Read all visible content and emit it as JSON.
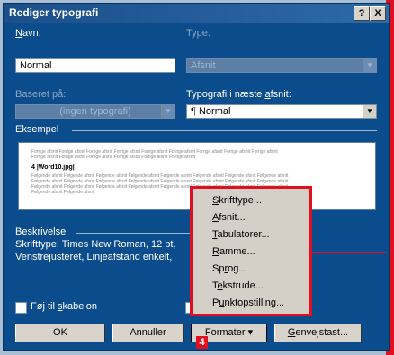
{
  "dialog": {
    "title": "Rediger typografi",
    "help_button": "?",
    "close_button": "X"
  },
  "fields": {
    "name_label_pre": "",
    "name_label_u": "N",
    "name_label_post": "avn:",
    "name_value": "Normal",
    "type_label": "Type:",
    "type_value": "Afsnit",
    "based_on_label": "Baseret på:",
    "based_on_value": "(ingen typografi)",
    "next_style_label_pre": "Typografi i næste ",
    "next_style_label_u": "a",
    "next_style_label_post": "fsnit:",
    "next_style_value": "¶ Normal"
  },
  "preview": {
    "heading": "Eksempel",
    "prev_lines": [
      "Forrige afsnit Forrige afsnit Forrige afsnit Forrige afsnit Forrige afsnit Forrige afsnit Forrige afsnit Forrige afsnit Forrige afsnit",
      "Forrige afsnit Forrige afsnit Forrige afsnit Forrige afsnit Forrige afsnit Forrige afsnit"
    ],
    "sample_text": "4 |Word10.jpg|",
    "next_lines": [
      "Følgende afsnit Følgende afsnit Følgende afsnit Følgende afsnit Følgende afsnit Følgende afsnit Følgende afsnit Følgende afsnit",
      "Følgende afsnit Følgende afsnit Følgende afsnit Følgende afsnit Følgende afsnit Følgende afsnit Følgende afsnit Følgende afsnit",
      "Følgende afsnit Følgende afsnit Følgende afsnit Følgende afsnit Følgende afsnit Følgende afsnit Følgende afsnit Følgende afsnit",
      "Følgende afsnit Følgende afsnit"
    ]
  },
  "description": {
    "heading": "Beskrivelse",
    "line1": "Skrifttype: Times New Roman, 12 pt,",
    "line2": "Venstrejusteret, Linjeafstand enkelt,"
  },
  "checkbox": {
    "add_to_template_pre": "Føj til ",
    "add_to_template_u": "s",
    "add_to_template_post": "kabelon"
  },
  "buttons": {
    "ok": "OK",
    "cancel": "Annuller",
    "format": "Formater",
    "shortcut_pre": "",
    "shortcut_u": "G",
    "shortcut_post": "envejstast..."
  },
  "menu": {
    "items": [
      {
        "pre": "",
        "u": "S",
        "post": "krifttype..."
      },
      {
        "pre": "",
        "u": "A",
        "post": "fsnit..."
      },
      {
        "pre": "",
        "u": "T",
        "post": "abulatorer..."
      },
      {
        "pre": "",
        "u": "R",
        "post": "amme..."
      },
      {
        "pre": "Sp",
        "u": "r",
        "post": "og..."
      },
      {
        "pre": "T",
        "u": "e",
        "post": "kstrude..."
      },
      {
        "pre": "P",
        "u": "u",
        "post": "nktopstilling..."
      }
    ]
  },
  "annotation": {
    "step_badge": "4",
    "accent_color": "#e01020"
  }
}
